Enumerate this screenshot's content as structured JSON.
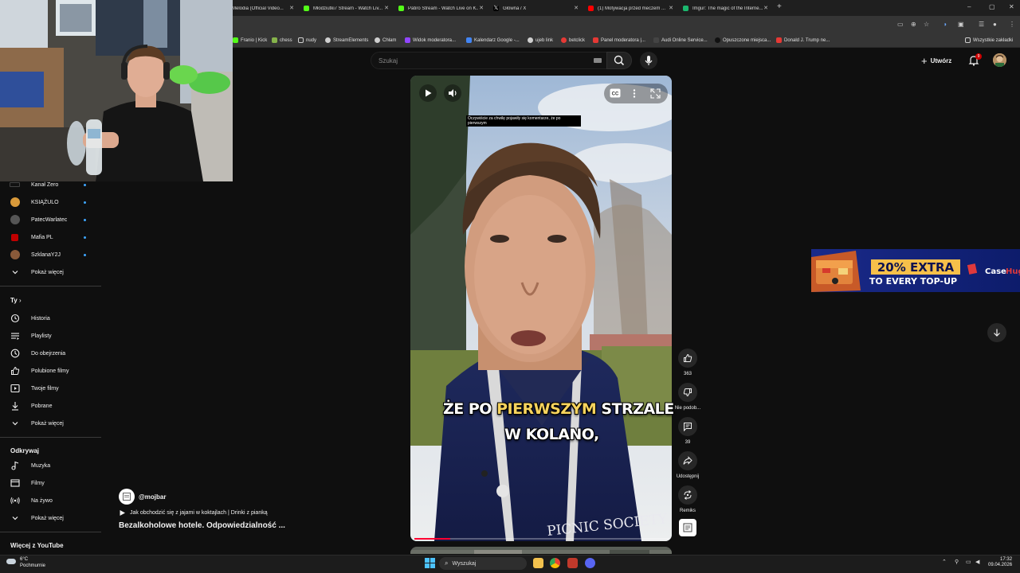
{
  "browser": {
    "tabs": [
      {
        "title": "Melodia (Official Video...",
        "color": "#e52d27"
      },
      {
        "title": "Młodziutki7 Stream - Watch Liv...",
        "color": "#53fc18"
      },
      {
        "title": "Patiro Stream - Watch Live on K...",
        "color": "#53fc18"
      },
      {
        "title": "Główna / X",
        "color": "#ffffff"
      },
      {
        "title": "(1) Motywacja przed meczem ...",
        "color": "#ff0000"
      },
      {
        "title": "Imgur: The magic of the Interne...",
        "color": "#1bb76e"
      }
    ],
    "new_tab": "+",
    "window_controls": {
      "minimize": "–",
      "restore": "▢",
      "close": "✕"
    },
    "bookmarks": [
      {
        "label": "Franio | Kick",
        "color": "#53fc18"
      },
      {
        "label": "chess",
        "color": "#86b34b"
      },
      {
        "label": "nudy",
        "color": "#cfcfcf"
      },
      {
        "label": "StreamElements",
        "color": "#cfcfcf"
      },
      {
        "label": "Chłam",
        "color": "#cfcfcf"
      },
      {
        "label": "Widok moderatora...",
        "color": "#9146ff"
      },
      {
        "label": "Kalendarz Google -...",
        "color": "#4285f4"
      },
      {
        "label": "ujeb link",
        "color": "#cfcfcf"
      },
      {
        "label": "betclick",
        "color": "#e53935"
      },
      {
        "label": "Panel moderatora |...",
        "color": "#e53935"
      },
      {
        "label": "Audi Online Service...",
        "color": "#444444"
      },
      {
        "label": "Opuszczone miejsca...",
        "color": "#222222"
      },
      {
        "label": "Donald J. Trump ne...",
        "color": "#e53935"
      }
    ],
    "all_bookmarks": "Wszystkie zakładki"
  },
  "header": {
    "search_placeholder": "Szukaj",
    "create_label": "Utwórz",
    "notification_count": "9"
  },
  "sidebar": {
    "subscriptions": [
      {
        "label": "Kanał Zero",
        "color": "#111111"
      },
      {
        "label": "KSIĄŻULO",
        "color": "#d99a3a"
      },
      {
        "label": "PatecWarlatec",
        "color": "#555555"
      },
      {
        "label": "Mafia PL",
        "color": "#c00000"
      },
      {
        "label": "SzklanaY2J",
        "color": "#8a5a3a"
      }
    ],
    "show_more_1": "Pokaż więcej",
    "you_heading": "Ty",
    "you_items": [
      {
        "label": "Historia",
        "icon": "history-icon"
      },
      {
        "label": "Playlisty",
        "icon": "playlists-icon"
      },
      {
        "label": "Do obejrzenia",
        "icon": "watch-later-icon"
      },
      {
        "label": "Polubione filmy",
        "icon": "liked-videos-icon"
      },
      {
        "label": "Twoje filmy",
        "icon": "your-videos-icon"
      },
      {
        "label": "Pobrane",
        "icon": "downloads-icon"
      }
    ],
    "show_more_2": "Pokaż więcej",
    "explore_heading": "Odkrywaj",
    "explore_items": [
      {
        "label": "Muzyka",
        "icon": "music-icon"
      },
      {
        "label": "Filmy",
        "icon": "movies-icon"
      },
      {
        "label": "Na żywo",
        "icon": "live-icon"
      }
    ],
    "show_more_3": "Pokaż więcej",
    "more_heading": "Więcej z YouTube"
  },
  "video": {
    "caption_text": "Oczywiście za chwilę pojawiły się komentarze, że po pierwszym",
    "subtitle_line1_a": "ŻE PO",
    "subtitle_line1_b": "PIERWSZYM",
    "subtitle_line1_c": "STRZALE",
    "subtitle_line2": "W KOLANO,",
    "progress": 0.14,
    "shirt_text": "PICNIC SOCIETY"
  },
  "actions": {
    "likes": "363",
    "dislike_label": "Nie podob...",
    "comments": "39",
    "share_label": "Udostępnij",
    "remix_label": "Remiks"
  },
  "channel": {
    "handle": "@mojbar",
    "playlist": "Jak obchodzić się z jajami w koktajlach | Drinki z pianką",
    "title": "Bezalkoholowe hotele. Odpowiedzialność ..."
  },
  "ad": {
    "headline": "20% EXTRA",
    "subline": "TO EVERY TOP-UP",
    "brand_a": "Case",
    "brand_b": "Hug"
  },
  "taskbar": {
    "weather_temp": "6°C",
    "weather_desc": "Pochmurnie",
    "search_label": "Wyszukaj",
    "time": "17:32",
    "date": "09.04.2026"
  }
}
